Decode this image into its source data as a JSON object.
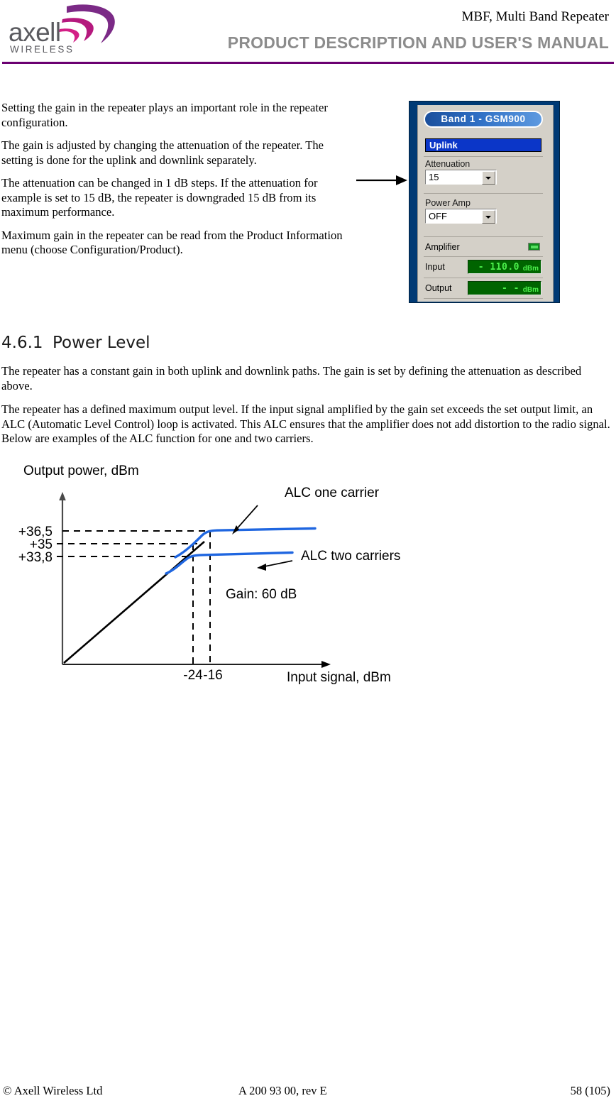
{
  "header": {
    "logo": {
      "name": "axell",
      "tagline": "WIRELESS"
    },
    "doc_title": "MBF, Multi Band Repeater",
    "manual_title": "PRODUCT DESCRIPTION AND USER'S MANUAL",
    "rule_color": "#6b0071"
  },
  "intro": {
    "paragraphs": [
      "Setting the gain in the repeater plays an important role in the repeater configuration.",
      "The gain is adjusted by changing the attenuation of the repeater. The setting is done for the uplink and downlink separately.",
      "The attenuation can be changed in 1 dB steps. If the attenuation for example is set to 15 dB, the repeater is downgraded 15 dB from its maximum performance.",
      "Maximum gain in the repeater can be read from the Product Information menu (choose Configuration/Product)."
    ]
  },
  "app_screenshot": {
    "band_title": "Band 1 - GSM900",
    "section_title": "Uplink",
    "attenuation": {
      "label": "Attenuation",
      "value": "15"
    },
    "power_amp": {
      "label": "Power Amp",
      "value": "OFF"
    },
    "amplifier": {
      "label": "Amplifier",
      "led_color": "#0f8c1e"
    },
    "input": {
      "label": "Input",
      "value": "- 110.0",
      "unit": "dBm"
    },
    "output": {
      "label": "Output",
      "value": "- -",
      "unit": "dBm"
    }
  },
  "section": {
    "number": "4.6.1",
    "title": "Power Level",
    "paragraphs": [
      "The repeater has a constant gain in both uplink and downlink paths. The gain is set by defining the attenuation as described above.",
      "The repeater has a defined maximum output level. If the input signal amplified by the gain set exceeds the set output limit, an ALC (Automatic Level Control) loop is activated. This ALC ensures that the amplifier does not add distortion to the radio signal. Below are examples of the ALC function for one and two carriers."
    ]
  },
  "chart_data": {
    "type": "line",
    "title": "",
    "xlabel": "Input signal, dBm",
    "ylabel": "Output power, dBm",
    "grid": false,
    "legend_position": "inline-annotation",
    "y_ticks": [
      "+36,5",
      "+35",
      "+33,8"
    ],
    "y_tick_values": [
      36.5,
      35,
      33.8
    ],
    "x_ticks": [
      "-24",
      "-16"
    ],
    "x_tick_values": [
      -24,
      -16
    ],
    "annotations": [
      {
        "text": "ALC one carrier",
        "series": "one-carrier"
      },
      {
        "text": "ALC two carriers",
        "series": "two-carriers"
      },
      {
        "text": "Gain: 60 dB",
        "series": "slope"
      }
    ],
    "series": [
      {
        "name": "Linear gain (60 dB)",
        "color": "#000000",
        "style": "solid",
        "points": [
          [
            -60,
            -24
          ],
          [
            -24,
            35
          ]
        ]
      },
      {
        "name": "ALC one carrier",
        "color": "#1f66e0",
        "style": "solid",
        "points": [
          [
            -27,
            31.5
          ],
          [
            -25,
            33.5
          ],
          [
            -23.5,
            35.8
          ],
          [
            -22.5,
            36.4
          ],
          [
            -16,
            36.5
          ],
          [
            -6,
            37.2
          ]
        ]
      },
      {
        "name": "ALC two carriers",
        "color": "#1f66e0",
        "style": "solid",
        "points": [
          [
            -30,
            31.2
          ],
          [
            -27.5,
            32.6
          ],
          [
            -26,
            33.5
          ],
          [
            -24,
            33.8
          ],
          [
            -16,
            33.9
          ],
          [
            -8,
            34.6
          ]
        ]
      }
    ],
    "guide_lines": [
      {
        "orientation": "horizontal",
        "value": 36.5,
        "style": "dashed"
      },
      {
        "orientation": "horizontal",
        "value": 35,
        "style": "dashed"
      },
      {
        "orientation": "horizontal",
        "value": 33.8,
        "style": "dashed"
      },
      {
        "orientation": "vertical",
        "value": -24,
        "style": "dashed"
      },
      {
        "orientation": "vertical",
        "value": -16,
        "style": "dashed"
      }
    ]
  },
  "footer": {
    "left": "© Axell Wireless Ltd",
    "center": "A 200 93 00, rev E",
    "right": "58 (105)"
  }
}
